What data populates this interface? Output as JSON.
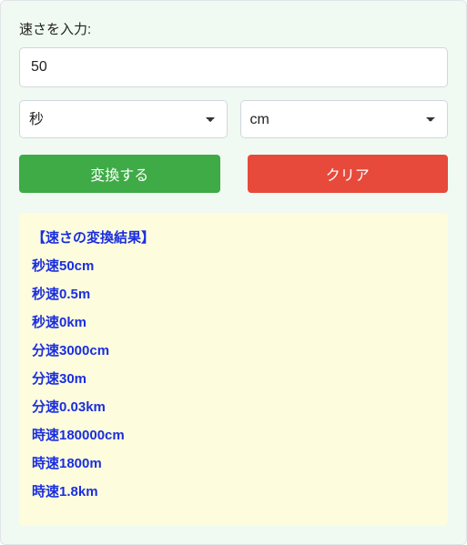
{
  "form": {
    "label": "速さを入力:",
    "value": "50",
    "time_unit": "秒",
    "distance_unit": "cm",
    "convert_label": "変換する",
    "clear_label": "クリア"
  },
  "result": {
    "title": "【速さの変換結果】",
    "lines": [
      "秒速50cm",
      "秒速0.5m",
      "秒速0km",
      "分速3000cm",
      "分速30m",
      "分速0.03km",
      "時速180000cm",
      "時速1800m",
      "時速1.8km"
    ]
  },
  "options": {
    "time": [
      "秒"
    ],
    "distance": [
      "cm"
    ]
  }
}
